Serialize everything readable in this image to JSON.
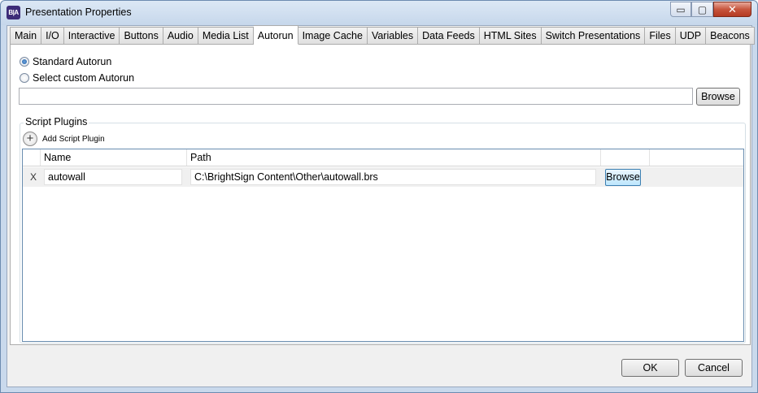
{
  "window": {
    "icon_text": "B|A",
    "title": "Presentation Properties",
    "controls": {
      "minimize": "▭",
      "maximize": "▢",
      "close": "✕"
    }
  },
  "tabs": [
    {
      "label": "Main"
    },
    {
      "label": "I/O"
    },
    {
      "label": "Interactive"
    },
    {
      "label": "Buttons"
    },
    {
      "label": "Audio"
    },
    {
      "label": "Media List"
    },
    {
      "label": "Autorun",
      "active": true
    },
    {
      "label": "Image Cache"
    },
    {
      "label": "Variables"
    },
    {
      "label": "Data Feeds"
    },
    {
      "label": "HTML Sites"
    },
    {
      "label": "Switch Presentations"
    },
    {
      "label": "Files"
    },
    {
      "label": "UDP"
    },
    {
      "label": "Beacons"
    }
  ],
  "autorun": {
    "standard_label": "Standard Autorun",
    "standard_selected": true,
    "custom_label": "Select custom Autorun",
    "custom_selected": false,
    "custom_path_value": "",
    "browse_label": "Browse"
  },
  "plugins": {
    "group_label": "Script Plugins",
    "add_icon": "+",
    "add_label": "Add Script Plugin",
    "columns": {
      "name": "Name",
      "path": "Path"
    },
    "rows": [
      {
        "remove": "X",
        "name": "autowall",
        "path": "C:\\BrightSign Content\\Other\\autowall.brs",
        "browse_label": "Browse"
      }
    ]
  },
  "footer": {
    "ok_label": "OK",
    "cancel_label": "Cancel"
  }
}
